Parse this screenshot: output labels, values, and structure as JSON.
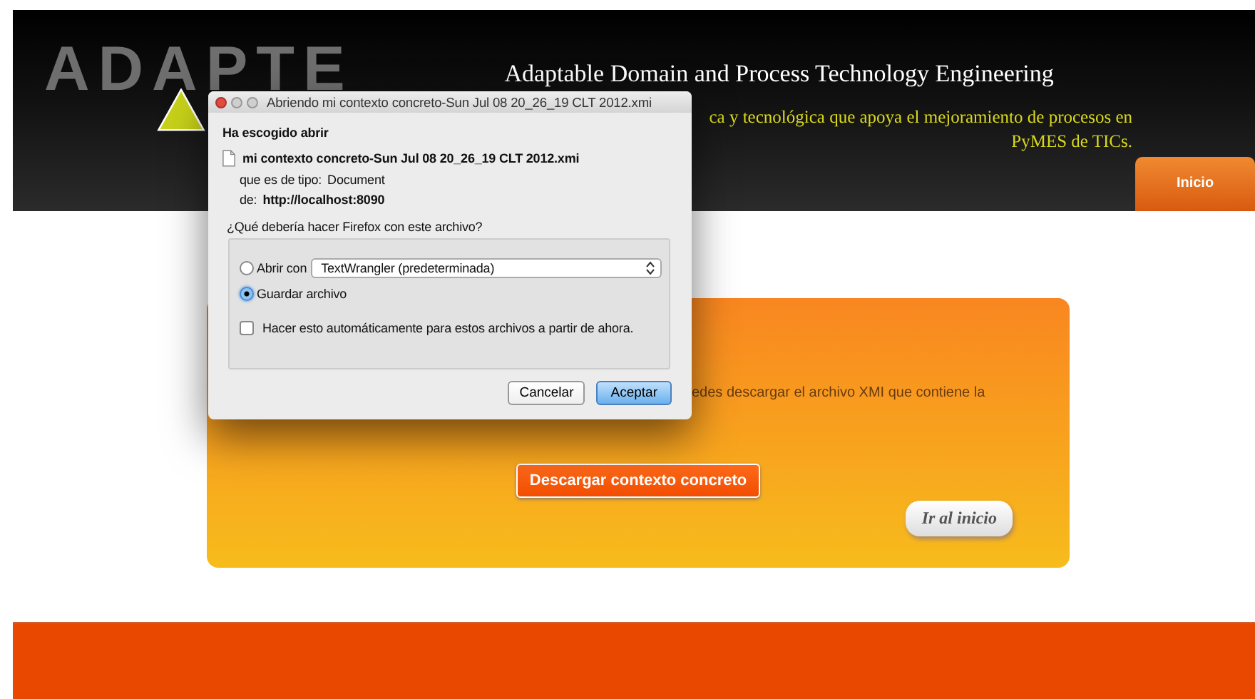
{
  "header": {
    "logo": "ADAPTE",
    "title": "Adaptable Domain and Process Technology Engineering",
    "subtitle_lines": [
      "ca y tecnológica que apoya el mejoramiento de procesos en",
      "PyMES de TICs."
    ],
    "nav": [
      {
        "label": "Inicio",
        "selected": true
      }
    ]
  },
  "card": {
    "text": "edes descargar el archivo XMI que contiene la",
    "download_button": "Descargar contexto concreto",
    "home_button": "Ir al inicio"
  },
  "dialog": {
    "title": "Abriendo mi contexto concreto-Sun Jul 08 20_26_19 CLT 2012.xmi",
    "heading": "Ha escogido abrir",
    "file_name": "mi contexto concreto-Sun Jul 08 20_26_19 CLT 2012.xmi",
    "type_label": "que es de tipo:",
    "type_value": "Document",
    "from_label": "de:",
    "from_value": "http://localhost:8090",
    "question": "¿Qué debería hacer Firefox con este archivo?",
    "options": [
      {
        "kind": "open-with",
        "label": "Abrir con",
        "app": "TextWrangler (predeterminada)",
        "selected": false
      },
      {
        "kind": "save",
        "label": "Guardar archivo",
        "selected": true
      }
    ],
    "remember": {
      "label": "Hacer esto automáticamente para estos archivos a partir de ahora.",
      "checked": false
    },
    "buttons": [
      {
        "label": "Cancelar",
        "default": false
      },
      {
        "label": "Aceptar",
        "default": true
      }
    ]
  }
}
